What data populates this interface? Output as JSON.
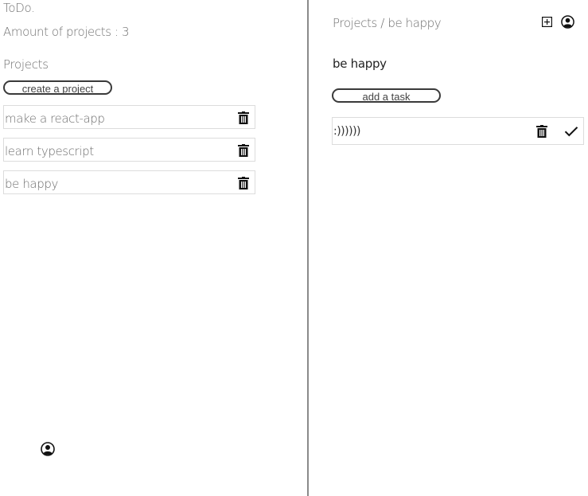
{
  "sidebar": {
    "app_title": "ToDo.",
    "projects_count_label": "Amount of projects : 3",
    "projects_heading": "Projects",
    "create_button_label": "create a project",
    "projects": [
      {
        "label": "make a react-app"
      },
      {
        "label": "learn typescript"
      },
      {
        "label": "be happy"
      }
    ],
    "avatar_icon": "user-circle-icon"
  },
  "main": {
    "breadcrumb": "Projects / be happy",
    "header_icons": [
      "plus-square-icon",
      "user-circle-icon"
    ],
    "project_title": "be happy",
    "add_task_label": "add a task",
    "tasks": [
      {
        "label": ":))))))",
        "icons": [
          "trash-icon",
          "check-icon"
        ]
      }
    ]
  },
  "colors": {
    "text_muted": "#707070",
    "text_dark": "#222222",
    "border": "#dcdcdc",
    "divider": "#8a8a8a"
  }
}
